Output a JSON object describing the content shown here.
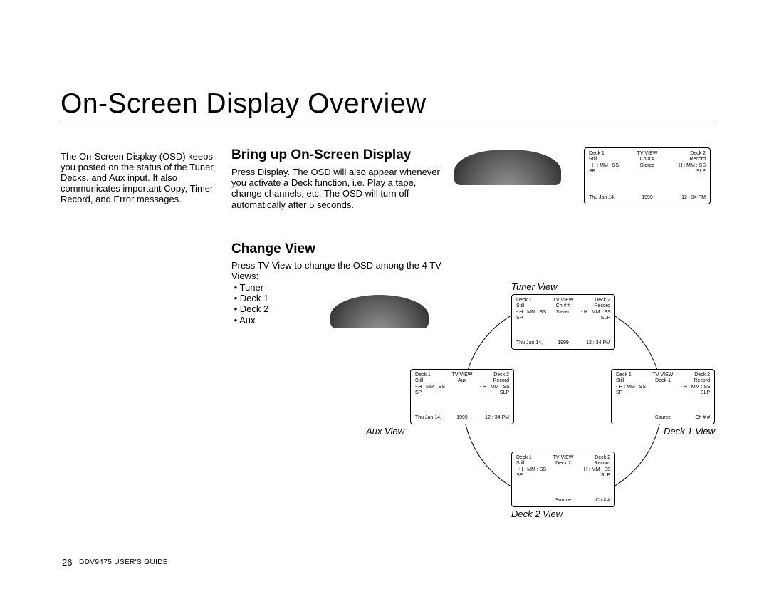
{
  "title": "On-Screen Display Overview",
  "intro": "The On-Screen Display (OSD) keeps you posted on the status of the Tuner, Decks, and Aux input. It also communicates important Copy, Timer Record, and Error messages.",
  "section1": {
    "heading": "Bring up On-Screen Display",
    "body": "Press Display. The OSD will also appear whenever you activate a Deck function, i.e. Play a tape, change channels, etc. The OSD will turn off automatically after 5 seconds."
  },
  "section2": {
    "heading": "Change View",
    "body_line1": "Press TV View to change the OSD among the 4 TV Views:",
    "items": [
      "Tuner",
      "Deck 1",
      "Deck 2",
      "Aux"
    ]
  },
  "view_labels": {
    "tuner": "Tuner View",
    "aux": "Aux View",
    "deck1": "Deck 1 View",
    "deck2": "Deck 2 View"
  },
  "osd_header": {
    "deck1_lbl": "Deck 1",
    "center_lbl": "TV VIEW",
    "deck2_lbl": "Deck 2",
    "row2_left": "Still",
    "row2_right": "Record",
    "row3_left": "- H : MM : SS",
    "row3_center": "Stereo",
    "row3_right": "- H : MM : SS",
    "row4_left": "SP",
    "row4_right": "SLP"
  },
  "osd_center_labels": {
    "tuner": "Ch # #",
    "aux": "Aux",
    "deck1": "Deck 1",
    "deck2": "Deck 2"
  },
  "osd_footer_date": {
    "date_left": "Thu  Jan  14,",
    "date_year": "1999",
    "time": "12 : 34  PM"
  },
  "osd_footer_source": {
    "source_lbl": "Source",
    "channel": "Ch # #"
  },
  "footer": {
    "page_num": "26",
    "guide": "DDV9475 USER'S GUIDE"
  }
}
